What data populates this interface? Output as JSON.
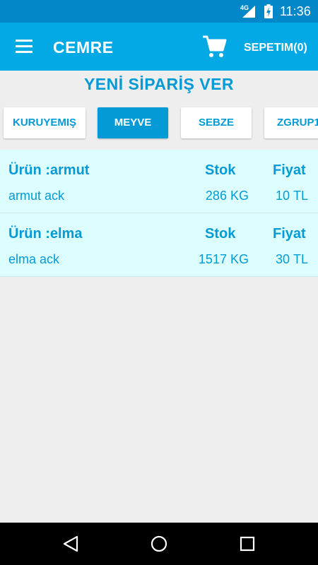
{
  "status_bar": {
    "network": "4G",
    "time": "11:36"
  },
  "app_bar": {
    "title": "CEMRE",
    "cart_label": "SEPETIM(0)"
  },
  "page": {
    "title": "YENİ SİPARİŞ VER"
  },
  "categories": [
    {
      "label": "KURUYEMIŞ",
      "active": false
    },
    {
      "label": "MEYVE",
      "active": true
    },
    {
      "label": "SEBZE",
      "active": false
    },
    {
      "label": "ZGRUP1",
      "active": false
    }
  ],
  "products": [
    {
      "name": "Ürün :armut",
      "desc": "armut ack",
      "stok_header": "Stok",
      "stok": "286",
      "unit": "KG",
      "fiyat_header": "Fiyat",
      "fiyat": "10",
      "currency": "TL"
    },
    {
      "name": "Ürün :elma",
      "desc": "elma ack",
      "stok_header": "Stok",
      "stok": "1517",
      "unit": "KG",
      "fiyat_header": "Fiyat",
      "fiyat": "30",
      "currency": "TL"
    }
  ],
  "colors": {
    "status_bar": "#0288c9",
    "app_bar": "#03a9e4",
    "accent": "#039ad6",
    "row_bg": "#dcfeff"
  },
  "icons": {
    "menu": "hamburger-icon",
    "cart": "cart-icon",
    "back": "back-triangle-icon",
    "home": "home-circle-icon",
    "recents": "recents-square-icon"
  }
}
